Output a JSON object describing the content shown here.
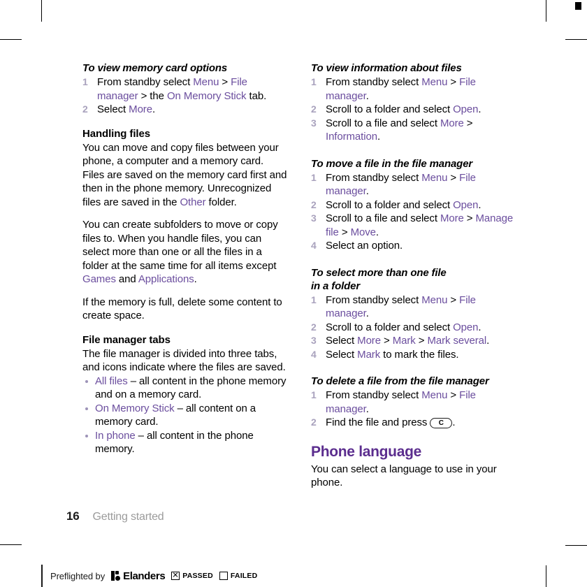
{
  "page": {
    "folio": "16",
    "running_head": "Getting started",
    "accent_heading_color": "#5b2d8e",
    "accent_link_color": "#6b4e9e",
    "step_number_color": "#a9a2bd"
  },
  "left_column": {
    "section_1": {
      "title": "To view memory card options",
      "steps": [
        {
          "parts": [
            {
              "text": "From standby select ",
              "ui": false
            },
            {
              "text": "Menu",
              "ui": true
            },
            {
              "text": " > ",
              "ui": false
            },
            {
              "text": "File manager",
              "ui": true
            },
            {
              "text": " > the ",
              "ui": false
            },
            {
              "text": "On Memory Stick",
              "ui": true
            },
            {
              "text": " tab.",
              "ui": false
            }
          ]
        },
        {
          "parts": [
            {
              "text": "Select ",
              "ui": false
            },
            {
              "text": "More",
              "ui": true
            },
            {
              "text": ".",
              "ui": false
            }
          ]
        }
      ]
    },
    "handling_files": {
      "heading": "Handling files",
      "paragraph_1_parts": [
        {
          "text": "You can move and copy files between your phone, a computer and a memory card. Files are saved on the memory card first and then in the phone memory. Unrecognized files are saved in the ",
          "ui": false
        },
        {
          "text": "Other",
          "ui": true
        },
        {
          "text": " folder.",
          "ui": false
        }
      ],
      "paragraph_2_parts": [
        {
          "text": "You can create subfolders to move or copy files to. When you handle files, you can select more than one or all the files in a folder at the same time for all items except ",
          "ui": false
        },
        {
          "text": "Games",
          "ui": true
        },
        {
          "text": " and ",
          "ui": false
        },
        {
          "text": "Applications",
          "ui": true
        },
        {
          "text": ".",
          "ui": false
        }
      ],
      "paragraph_3": "If the memory is full, delete some content to create space."
    },
    "file_manager_tabs": {
      "heading": "File manager tabs",
      "intro": "The file manager is divided into three tabs, and icons indicate where the files are saved.",
      "bullets": [
        {
          "parts": [
            {
              "text": "All files",
              "ui": true
            },
            {
              "text": " – all content in the phone memory and on a memory card.",
              "ui": false
            }
          ]
        },
        {
          "parts": [
            {
              "text": "On Memory Stick",
              "ui": true
            },
            {
              "text": " – all content on a memory card.",
              "ui": false
            }
          ]
        },
        {
          "parts": [
            {
              "text": "In phone",
              "ui": true
            },
            {
              "text": " – all content in the phone memory.",
              "ui": false
            }
          ]
        }
      ]
    }
  },
  "right_column": {
    "section_view_info": {
      "title": "To view information about files",
      "steps": [
        {
          "parts": [
            {
              "text": "From standby select ",
              "ui": false
            },
            {
              "text": "Menu",
              "ui": true
            },
            {
              "text": " > ",
              "ui": false
            },
            {
              "text": "File manager",
              "ui": true
            },
            {
              "text": ".",
              "ui": false
            }
          ]
        },
        {
          "parts": [
            {
              "text": "Scroll to a folder and select ",
              "ui": false
            },
            {
              "text": "Open",
              "ui": true
            },
            {
              "text": ".",
              "ui": false
            }
          ]
        },
        {
          "parts": [
            {
              "text": "Scroll to a file and select ",
              "ui": false
            },
            {
              "text": "More",
              "ui": true
            },
            {
              "text": " > ",
              "ui": false
            },
            {
              "text": "Information",
              "ui": true
            },
            {
              "text": ".",
              "ui": false
            }
          ]
        }
      ]
    },
    "section_move_file": {
      "title": "To move a file in the file manager",
      "steps": [
        {
          "parts": [
            {
              "text": "From standby select ",
              "ui": false
            },
            {
              "text": "Menu",
              "ui": true
            },
            {
              "text": " > ",
              "ui": false
            },
            {
              "text": "File manager",
              "ui": true
            },
            {
              "text": ".",
              "ui": false
            }
          ]
        },
        {
          "parts": [
            {
              "text": "Scroll to a folder and select ",
              "ui": false
            },
            {
              "text": "Open",
              "ui": true
            },
            {
              "text": ".",
              "ui": false
            }
          ]
        },
        {
          "parts": [
            {
              "text": "Scroll to a file and select ",
              "ui": false
            },
            {
              "text": "More",
              "ui": true
            },
            {
              "text": " > ",
              "ui": false
            },
            {
              "text": "Manage file",
              "ui": true
            },
            {
              "text": " > ",
              "ui": false
            },
            {
              "text": "Move",
              "ui": true
            },
            {
              "text": ".",
              "ui": false
            }
          ]
        },
        {
          "parts": [
            {
              "text": "Select an option.",
              "ui": false
            }
          ]
        }
      ]
    },
    "section_select_more": {
      "title_line_1": "To select more than one file",
      "title_line_2": "in a folder",
      "steps": [
        {
          "parts": [
            {
              "text": "From standby select ",
              "ui": false
            },
            {
              "text": "Menu",
              "ui": true
            },
            {
              "text": " > ",
              "ui": false
            },
            {
              "text": "File manager",
              "ui": true
            },
            {
              "text": ".",
              "ui": false
            }
          ]
        },
        {
          "parts": [
            {
              "text": "Scroll to a folder and select ",
              "ui": false
            },
            {
              "text": "Open",
              "ui": true
            },
            {
              "text": ".",
              "ui": false
            }
          ]
        },
        {
          "parts": [
            {
              "text": "Select ",
              "ui": false
            },
            {
              "text": "More",
              "ui": true
            },
            {
              "text": " > ",
              "ui": false
            },
            {
              "text": "Mark",
              "ui": true
            },
            {
              "text": " > ",
              "ui": false
            },
            {
              "text": "Mark several",
              "ui": true
            },
            {
              "text": ".",
              "ui": false
            }
          ]
        },
        {
          "parts": [
            {
              "text": "Select ",
              "ui": false
            },
            {
              "text": "Mark",
              "ui": true
            },
            {
              "text": " to mark the files.",
              "ui": false
            }
          ]
        }
      ]
    },
    "section_delete_file": {
      "title": "To delete a file from the file manager",
      "steps": [
        {
          "parts": [
            {
              "text": "From standby select ",
              "ui": false
            },
            {
              "text": "Menu",
              "ui": true
            },
            {
              "text": " > ",
              "ui": false
            },
            {
              "text": "File manager",
              "ui": true
            },
            {
              "text": ".",
              "ui": false
            }
          ]
        },
        {
          "parts": [
            {
              "text": "Find the file and press ",
              "ui": false
            },
            {
              "key": "C"
            },
            {
              "text": ".",
              "ui": false
            }
          ]
        }
      ]
    },
    "section_phone_language": {
      "heading": "Phone language",
      "paragraph": "You can select a language to use in your phone."
    }
  },
  "preflight": {
    "label": "Preflighted by",
    "brand": "Elanders",
    "passed_label": "PASSED",
    "failed_label": "FAILED",
    "passed_checked": true,
    "failed_checked": false
  }
}
